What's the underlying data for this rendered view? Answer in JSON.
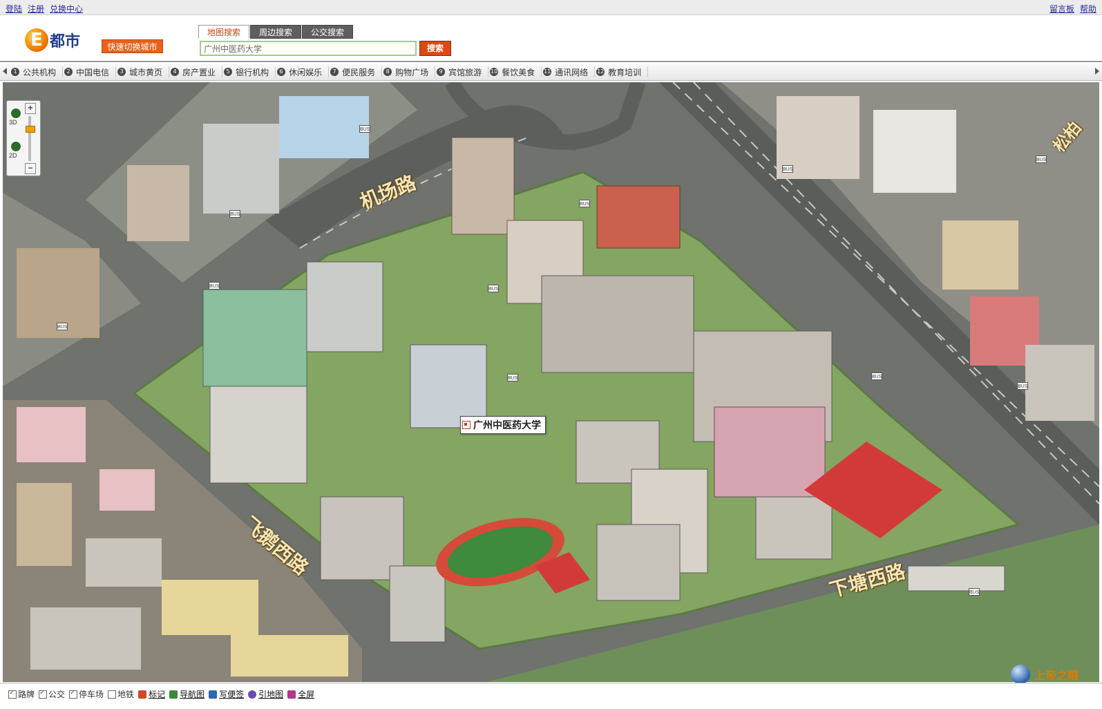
{
  "topbar": {
    "links_left": [
      "登陆",
      "注册",
      "兑换中心"
    ],
    "links_right": [
      "留言板",
      "帮助"
    ]
  },
  "header": {
    "logo_text": "都市",
    "logo_letter": "E",
    "switch_city_label": "快速切换城市",
    "tabs": [
      "地图搜索",
      "周边搜索",
      "公交搜索"
    ],
    "active_tab": "地图搜索",
    "search_value": "广州中医药大学",
    "search_button": "搜索"
  },
  "categories": [
    {
      "num": "1",
      "label": "公共机构"
    },
    {
      "num": "2",
      "label": "中国电信"
    },
    {
      "num": "3",
      "label": "城市黄页"
    },
    {
      "num": "4",
      "label": "房产置业"
    },
    {
      "num": "5",
      "label": "银行机构"
    },
    {
      "num": "6",
      "label": "休闲娱乐"
    },
    {
      "num": "7",
      "label": "便民服务"
    },
    {
      "num": "8",
      "label": "购物广场"
    },
    {
      "num": "9",
      "label": "宾馆旅游"
    },
    {
      "num": "10",
      "label": "餐饮美食"
    },
    {
      "num": "11",
      "label": "通讯网络"
    },
    {
      "num": "12",
      "label": "教育培训"
    }
  ],
  "map": {
    "zoom": {
      "label_3d": "3D",
      "label_2d": "2D",
      "plus": "+",
      "minus": "−"
    },
    "road_labels": [
      "机场路",
      "飞鹅西路",
      "下塘西路",
      "松柏"
    ],
    "poi_label": "广州中医药大学",
    "bus_sign": "BUS",
    "colors": {
      "road": "#6e716c",
      "grass": "#7fa05e",
      "track": "#d64a3a",
      "field": "#3f8a3c",
      "court": "#d23a3a"
    }
  },
  "bottombar": {
    "checkboxes": [
      {
        "label": "路牌",
        "checked": true
      },
      {
        "label": "公交",
        "checked": true
      },
      {
        "label": "停车场",
        "checked": true
      },
      {
        "label": "地铁",
        "checked": false
      }
    ],
    "tools": [
      {
        "label": "标记",
        "icon": "pin-icon"
      },
      {
        "label": "导航图",
        "icon": "nav-map-icon"
      },
      {
        "label": "写便签",
        "icon": "note-icon"
      },
      {
        "label": "引地图",
        "icon": "link-map-icon"
      },
      {
        "label": "全屏",
        "icon": "fullscreen-icon"
      }
    ]
  },
  "brand": {
    "name": "上帝之眼"
  }
}
